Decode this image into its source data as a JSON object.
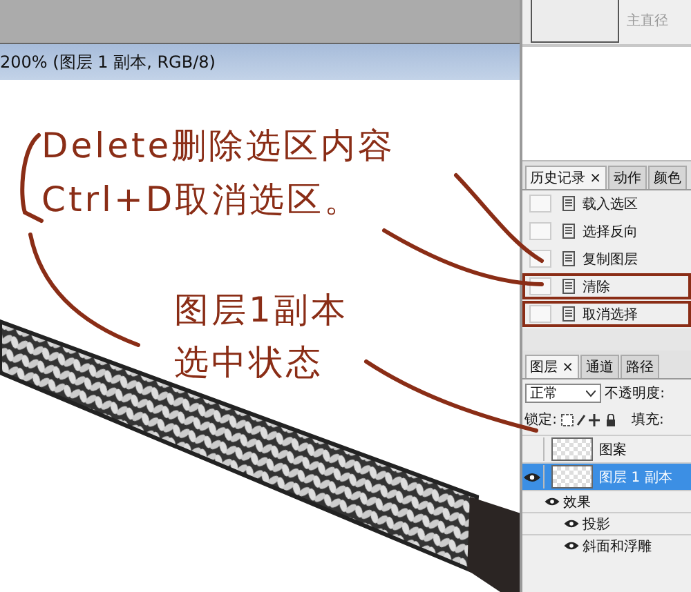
{
  "document": {
    "title": "200% (图层 1 副本, RGB/8)"
  },
  "annotations": [
    {
      "text": "Delete删除选区内容"
    },
    {
      "text": "Ctrl+D取消选区。"
    },
    {
      "text": "图层1副本"
    },
    {
      "text": "选中状态"
    }
  ],
  "navigator": {
    "label": "主直径"
  },
  "history": {
    "tabs": [
      {
        "label": "历史记录",
        "close": "×",
        "selected": true
      },
      {
        "label": "动作",
        "selected": false
      },
      {
        "label": "颜色",
        "selected": false
      }
    ],
    "items": [
      {
        "label": "载入选区",
        "highlighted": false
      },
      {
        "label": "选择反向",
        "highlighted": false
      },
      {
        "label": "复制图层",
        "highlighted": false
      },
      {
        "label": "清除",
        "highlighted": true
      },
      {
        "label": "取消选择",
        "highlighted": true
      }
    ]
  },
  "layers": {
    "tabs": [
      {
        "label": "图层",
        "close": "×",
        "selected": true
      },
      {
        "label": "通道",
        "selected": false
      },
      {
        "label": "路径",
        "selected": false
      }
    ],
    "blend_mode": "正常",
    "opacity_label": "不透明度:",
    "lock_label": "锁定:",
    "fill_label": "填充:",
    "items": [
      {
        "name": "图案",
        "visible": false,
        "selected": false
      },
      {
        "name": "图层 1 副本",
        "visible": true,
        "selected": true,
        "children": [
          {
            "name": "效果",
            "visible": true,
            "children": [
              {
                "name": "投影",
                "visible": true
              },
              {
                "name": "斜面和浮雕",
                "visible": true
              }
            ]
          }
        ]
      }
    ]
  }
}
